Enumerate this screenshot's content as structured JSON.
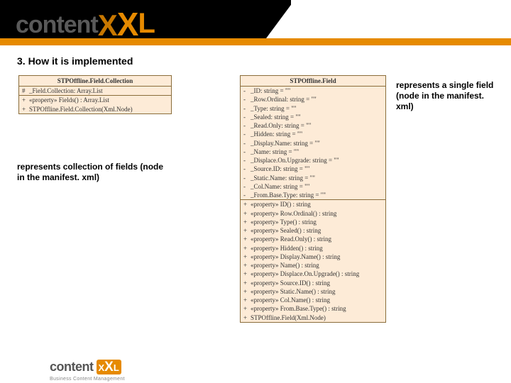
{
  "topLogo": "contentXXL",
  "heading": "3. How it is implemented",
  "leftUml": {
    "title": "STPOffline.Field.Collection",
    "attributes": [
      {
        "vis": "#",
        "text": "_Field.Collection: Array.List"
      }
    ],
    "operations": [
      {
        "vis": "+",
        "text": "«property» Fields() : Array.List"
      },
      {
        "vis": "+",
        "text": "STPOffline.Field.Collection(Xml.Node)"
      }
    ]
  },
  "rightUml": {
    "title": "STPOffline.Field",
    "attributes": [
      {
        "vis": "-",
        "text": "_ID: string = \"\""
      },
      {
        "vis": "-",
        "text": "_Row.Ordinal: string = \"\""
      },
      {
        "vis": "-",
        "text": "_Type: string = \"\""
      },
      {
        "vis": "-",
        "text": "_Sealed: string = \"\""
      },
      {
        "vis": "-",
        "text": "_Read.Only: string = \"\""
      },
      {
        "vis": "-",
        "text": "_Hidden: string = \"\""
      },
      {
        "vis": "-",
        "text": "_Display.Name: string = \"\""
      },
      {
        "vis": "-",
        "text": "_Name: string = \"\""
      },
      {
        "vis": "-",
        "text": "_Displace.On.Upgrade: string = \"\""
      },
      {
        "vis": "-",
        "text": "_Source.ID: string = \"\""
      },
      {
        "vis": "-",
        "text": "_Static.Name: string = \"\""
      },
      {
        "vis": "-",
        "text": "_Col.Name: string = \"\""
      },
      {
        "vis": "-",
        "text": "_From.Base.Type: string = \"\""
      }
    ],
    "operations": [
      {
        "vis": "+",
        "text": "«property» ID() : string"
      },
      {
        "vis": "+",
        "text": "«property» Row.Ordinal() : string"
      },
      {
        "vis": "+",
        "text": "«property» Type() : string"
      },
      {
        "vis": "+",
        "text": "«property» Sealed() : string"
      },
      {
        "vis": "+",
        "text": "«property» Read.Only() : string"
      },
      {
        "vis": "+",
        "text": "«property» Hidden() : string"
      },
      {
        "vis": "+",
        "text": "«property» Display.Name() : string"
      },
      {
        "vis": "+",
        "text": "«property» Name() : string"
      },
      {
        "vis": "+",
        "text": "«property» Displace.On.Upgrade() : string"
      },
      {
        "vis": "+",
        "text": "«property» Source.ID() : string"
      },
      {
        "vis": "+",
        "text": "«property» Static.Name() : string"
      },
      {
        "vis": "+",
        "text": "«property» Col.Name() : string"
      },
      {
        "vis": "+",
        "text": "«property» From.Base.Type() : string"
      },
      {
        "vis": "+",
        "text": "STPOffline.Field(Xml.Node)"
      }
    ]
  },
  "captionLeft": "represents collection of fields (node in the manifest. xml)",
  "captionRight": "represents a single field (node in the manifest. xml)",
  "bottomLogo": {
    "text": "content",
    "badge1": "X",
    "badge2": "X",
    "badge3": "L",
    "tagline": "Business Content Management"
  }
}
